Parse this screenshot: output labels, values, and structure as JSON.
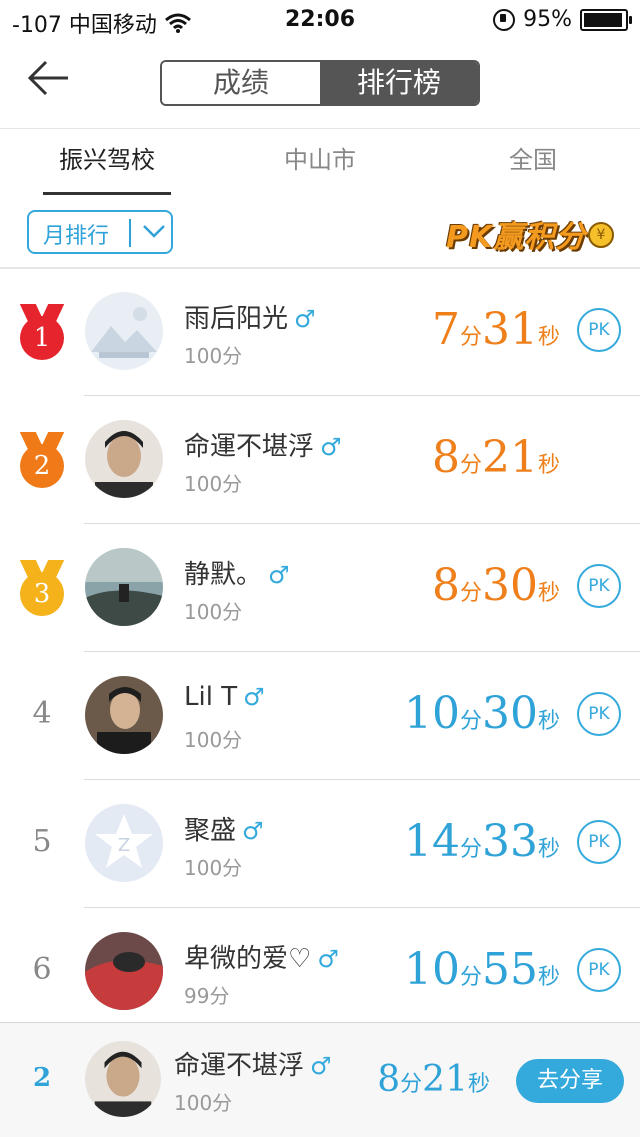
{
  "status_bar": {
    "carrier": "-107 中国移动",
    "time": "22:06",
    "battery": "95%"
  },
  "header": {
    "back_icon": "arrow-left-icon",
    "segments": [
      {
        "label": "成绩",
        "active": false
      },
      {
        "label": "排行榜",
        "active": true
      }
    ]
  },
  "tabs": [
    {
      "label": "振兴驾校",
      "active": true
    },
    {
      "label": "中山市",
      "active": false
    },
    {
      "label": "全国",
      "active": false
    }
  ],
  "filter": {
    "label": "月排行",
    "icon": "chevron-down-icon"
  },
  "promo": {
    "text": "PK赢积分",
    "coin_symbol": "¥"
  },
  "leaderboard": [
    {
      "rank": "1",
      "name": "雨后阳光",
      "gender": "♂",
      "points": "100分",
      "min": "7",
      "sec": "31",
      "min_unit": "分",
      "sec_unit": "秒",
      "pk": "PK",
      "medal_color": "#e5242d",
      "time_color": "#ef7f1a"
    },
    {
      "rank": "2",
      "name": "命運不堪浮",
      "gender": "♂",
      "points": "100分",
      "min": "8",
      "sec": "21",
      "min_unit": "分",
      "sec_unit": "秒",
      "pk": "",
      "medal_color": "#f07a17",
      "time_color": "#ef7f1a"
    },
    {
      "rank": "3",
      "name": "静默。",
      "gender": "♂",
      "points": "100分",
      "min": "8",
      "sec": "30",
      "min_unit": "分",
      "sec_unit": "秒",
      "pk": "PK",
      "medal_color": "#f5b21a",
      "time_color": "#ef7f1a"
    },
    {
      "rank": "4",
      "name": "Lil T",
      "gender": "♂",
      "points": "100分",
      "min": "10",
      "sec": "30",
      "min_unit": "分",
      "sec_unit": "秒",
      "pk": "PK",
      "time_color": "#2fa2d8"
    },
    {
      "rank": "5",
      "name": "聚盛",
      "gender": "♂",
      "points": "100分",
      "min": "14",
      "sec": "33",
      "min_unit": "分",
      "sec_unit": "秒",
      "pk": "PK",
      "time_color": "#2fa2d8"
    },
    {
      "rank": "6",
      "name": "卑微的爱♡",
      "gender": "♂",
      "points": "99分",
      "min": "10",
      "sec": "55",
      "min_unit": "分",
      "sec_unit": "秒",
      "pk": "PK",
      "time_color": "#2fa2d8"
    }
  ],
  "my_entry": {
    "rank": "2",
    "name": "命運不堪浮",
    "gender": "♂",
    "points": "100分",
    "min": "8",
    "sec": "21",
    "min_unit": "分",
    "sec_unit": "秒",
    "share_label": "去分享"
  }
}
